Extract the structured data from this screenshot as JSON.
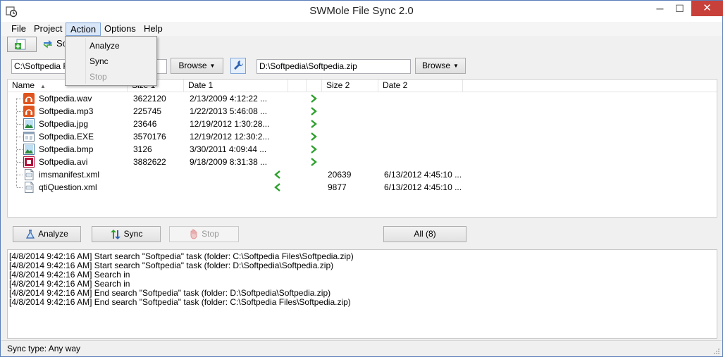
{
  "window": {
    "title": "SWMole File Sync 2.0",
    "min": "─",
    "max": "☐",
    "close": "✕"
  },
  "menu": [
    {
      "label": "File"
    },
    {
      "label": "Project"
    },
    {
      "label": "Action"
    },
    {
      "label": "Options"
    },
    {
      "label": "Help"
    }
  ],
  "toolbar": {
    "tab_label": "So"
  },
  "action_menu": [
    {
      "label": "Analyze",
      "enabled": true
    },
    {
      "label": "Sync",
      "enabled": true
    },
    {
      "label": "Stop",
      "enabled": false
    }
  ],
  "paths": {
    "left": "C:\\Softpedia Fi",
    "right": "D:\\Softpedia\\Softpedia.zip",
    "browse_label": "Browse",
    "browse_arrow": "▼"
  },
  "columns": {
    "name": "Name",
    "size1": "Size 1",
    "date1": "Date 1",
    "size2": "Size 2",
    "date2": "Date 2",
    "sort_arrow": "▲"
  },
  "files": [
    {
      "name": "Softpedia.wav",
      "icon": "audio-file-icon",
      "size1": "3622120",
      "date1": "2/13/2009 4:12:22 ...",
      "direction": "right",
      "size2": "",
      "date2": ""
    },
    {
      "name": "Softpedia.mp3",
      "icon": "audio-file-icon",
      "size1": "225745",
      "date1": "1/22/2013 5:46:08 ...",
      "direction": "right",
      "size2": "",
      "date2": ""
    },
    {
      "name": "Softpedia.jpg",
      "icon": "image-file-icon",
      "size1": "23646",
      "date1": "12/19/2012 1:30:28...",
      "direction": "right",
      "size2": "",
      "date2": ""
    },
    {
      "name": "Softpedia.EXE",
      "icon": "exe-file-icon",
      "size1": "3570176",
      "date1": "12/19/2012 12:30:2...",
      "direction": "right",
      "size2": "",
      "date2": ""
    },
    {
      "name": "Softpedia.bmp",
      "icon": "image-file-icon",
      "size1": "3126",
      "date1": "3/30/2011 4:09:44 ...",
      "direction": "right",
      "size2": "",
      "date2": ""
    },
    {
      "name": "Softpedia.avi",
      "icon": "video-file-icon",
      "size1": "3882622",
      "date1": "9/18/2009 8:31:38 ...",
      "direction": "right",
      "size2": "",
      "date2": ""
    },
    {
      "name": "imsmanifest.xml",
      "icon": "xml-file-icon",
      "size1": "",
      "date1": "",
      "direction": "left",
      "size2": "20639",
      "date2": "6/13/2012 4:45:10 ..."
    },
    {
      "name": "qtiQuestion.xml",
      "icon": "xml-file-icon",
      "size1": "",
      "date1": "",
      "direction": "left",
      "size2": "9877",
      "date2": "6/13/2012 4:45:10 ..."
    }
  ],
  "buttons": {
    "analyze": "Analyze",
    "sync": "Sync",
    "stop": "Stop",
    "all": "All (8)"
  },
  "log": [
    "[4/8/2014 9:42:16 AM] Start search \"Softpedia\" task (folder: C:\\Softpedia Files\\Softpedia.zip)",
    "[4/8/2014 9:42:16 AM] Start search \"Softpedia\" task (folder: D:\\Softpedia\\Softpedia.zip)",
    "[4/8/2014 9:42:16 AM] Search in",
    "[4/8/2014 9:42:16 AM] Search in",
    "[4/8/2014 9:42:16 AM] End search \"Softpedia\" task (folder: D:\\Softpedia\\Softpedia.zip)",
    "[4/8/2014 9:42:16 AM] End search \"Softpedia\" task (folder: C:\\Softpedia Files\\Softpedia.zip)"
  ],
  "status": {
    "text": "Sync type: Any way"
  },
  "colors": {
    "accent": "#7ea4d8",
    "arrow_green": "#2ea02e",
    "close_red": "#c7413a"
  }
}
